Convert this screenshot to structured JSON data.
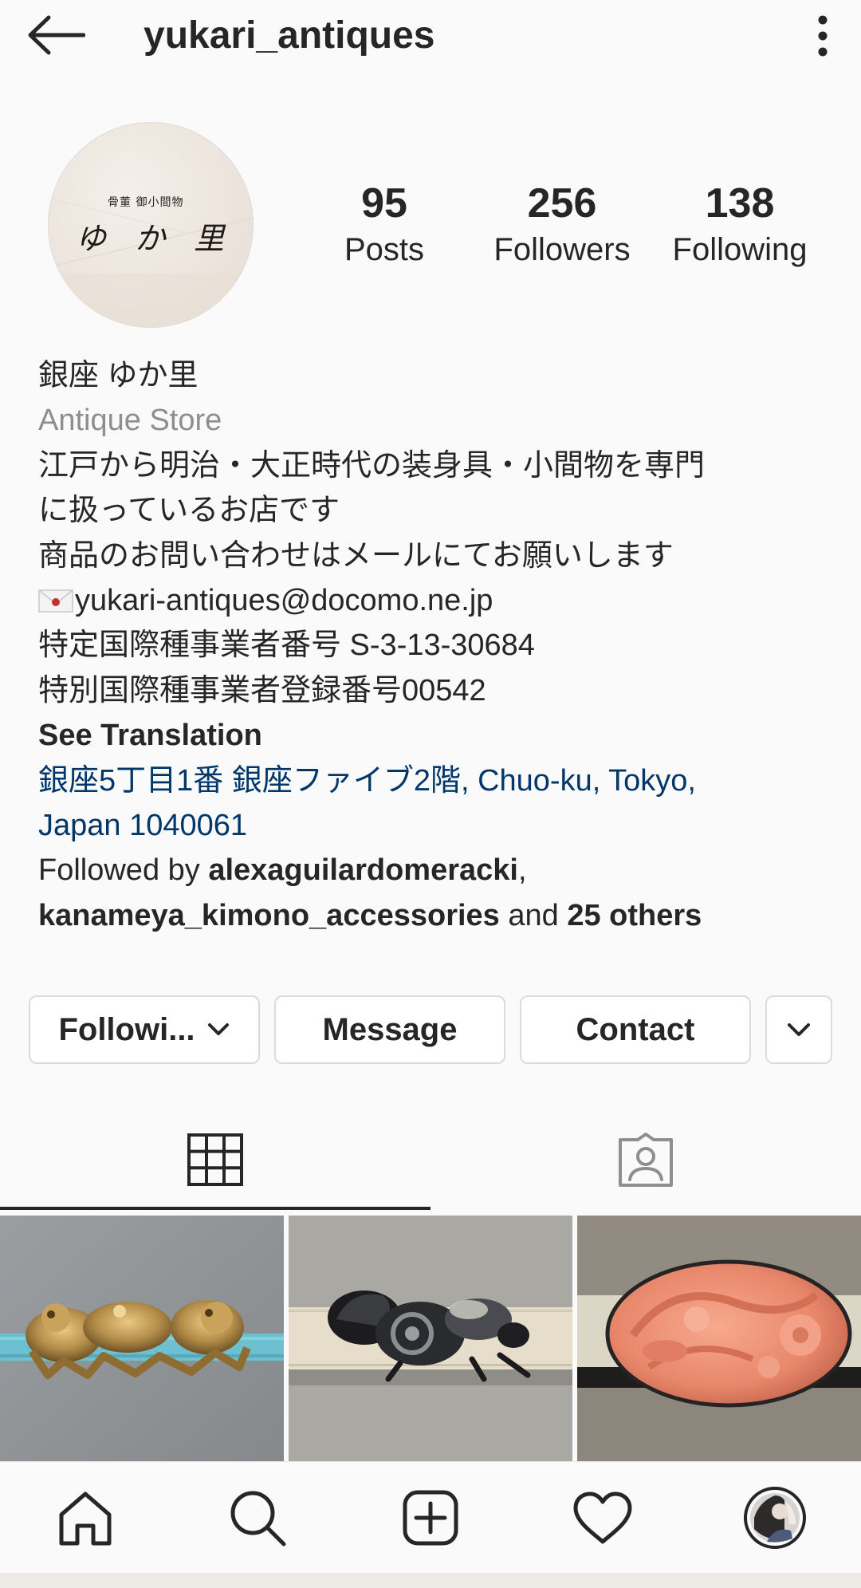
{
  "header": {
    "username": "yukari_antiques"
  },
  "profile": {
    "avatar_text_small": "骨董 御小間物",
    "avatar_text_large": "ゆ か 里",
    "stats": [
      {
        "value": "95",
        "label": "Posts"
      },
      {
        "value": "256",
        "label": "Followers"
      },
      {
        "value": "138",
        "label": "Following"
      }
    ]
  },
  "bio": {
    "name": "銀座 ゆか里",
    "category": "Antique Store",
    "description_lines": [
      "江戸から明治・大正時代の装身具・小間物を専門",
      "に扱っているお店です",
      "商品のお問い合わせはメールにてお願いします"
    ],
    "email": "yukari-antiques@docomo.ne.jp",
    "license_lines": [
      "特定国際種事業者番号 S-3-13-30684",
      "特別国際種事業者登録番号00542"
    ],
    "see_translation": "See Translation",
    "address_lines": [
      "銀座5丁目1番 銀座ファイブ2階, Chuo-ku, Tokyo,",
      "Japan 1040061"
    ],
    "followed_by": {
      "prefix": "Followed by ",
      "user1": "alexaguilardomeracki",
      "sep": ",",
      "user2": "kanameya_kimono_accessories",
      "and": " and ",
      "others": "25 others"
    }
  },
  "actions": {
    "following_label": "Followi...",
    "message_label": "Message",
    "contact_label": "Contact"
  },
  "tabs": [
    "grid",
    "tagged"
  ],
  "grid_posts": [
    {
      "subject": "gold lion obidome",
      "bg": "#8f9396",
      "cord": "#6cc0cf"
    },
    {
      "subject": "black silver beetle obidome",
      "bg": "#aaa9a3",
      "cord": "#e8dfcc"
    },
    {
      "subject": "coral flower obidome",
      "bg": "#8a847b",
      "cord": "#ded8c8"
    }
  ],
  "nav": [
    "home-icon",
    "search-icon",
    "add-post-icon",
    "activity-heart-icon",
    "profile-avatar-icon"
  ],
  "colors": {
    "text": "#262626",
    "muted": "#8e8e8e",
    "link": "#00376b",
    "border": "#dbdbdb",
    "background": "#fafafa"
  }
}
